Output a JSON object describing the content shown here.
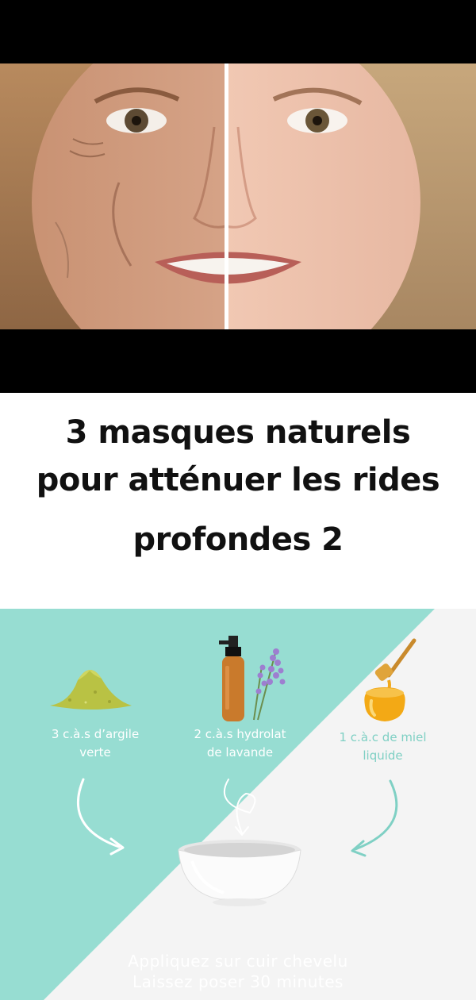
{
  "title": {
    "line1": "3 masques naturels",
    "line2": "pour atténuer les rides",
    "line3": "profondes 2"
  },
  "ingredients": [
    {
      "label": "3 c.à.s d’argile verte",
      "line1": "3 c.à.s d’argile",
      "line2": "verte",
      "icon": "green-clay-icon"
    },
    {
      "label": "2 c.à.s hydrolat de lavande",
      "line1": "2 c.à.s hydrolat",
      "line2": "de lavande",
      "icon": "lavender-spray-bottle-icon"
    },
    {
      "label": "1 c.à.c de miel liquide",
      "line1": "1 c.à.c de miel",
      "line2": "liquide",
      "icon": "honey-jar-icon"
    }
  ],
  "instructions": {
    "line1": "Appliquez sur cuir chevelu",
    "line2": "Laissez poser 30 minutes"
  },
  "colors": {
    "teal": "#97ddd2",
    "gray_bg": "#f4f4f4",
    "label_on_gray": "#7fd0c4",
    "title_text": "#111111"
  }
}
